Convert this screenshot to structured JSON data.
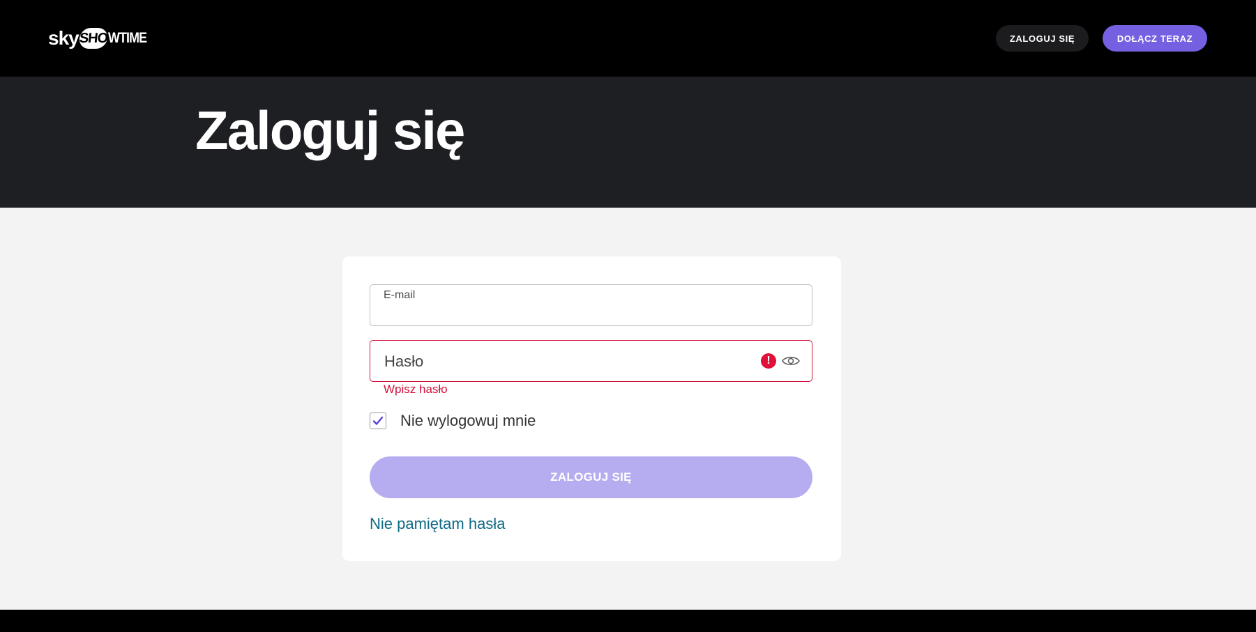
{
  "header": {
    "logo": {
      "sky": "sky",
      "show": "SHO",
      "time": "WTIME"
    },
    "login_label": "ZALOGUJ SIĘ",
    "join_label": "DOŁĄCZ TERAZ"
  },
  "hero": {
    "title": "Zaloguj się"
  },
  "form": {
    "email_label": "E-mail",
    "email_value": "",
    "password_placeholder": "Hasło",
    "password_error_icon": "alert-icon",
    "password_error": "Wpisz hasło",
    "remember_label": "Nie wylogowuj mnie",
    "remember_checked": true,
    "submit_label": "ZALOGUJ SIĘ",
    "forgot_label": "Nie pamiętam hasła"
  },
  "colors": {
    "accent": "#7460e0",
    "error": "#d0103a",
    "link": "#0f6a86",
    "submit_disabled": "#b6adf1"
  }
}
